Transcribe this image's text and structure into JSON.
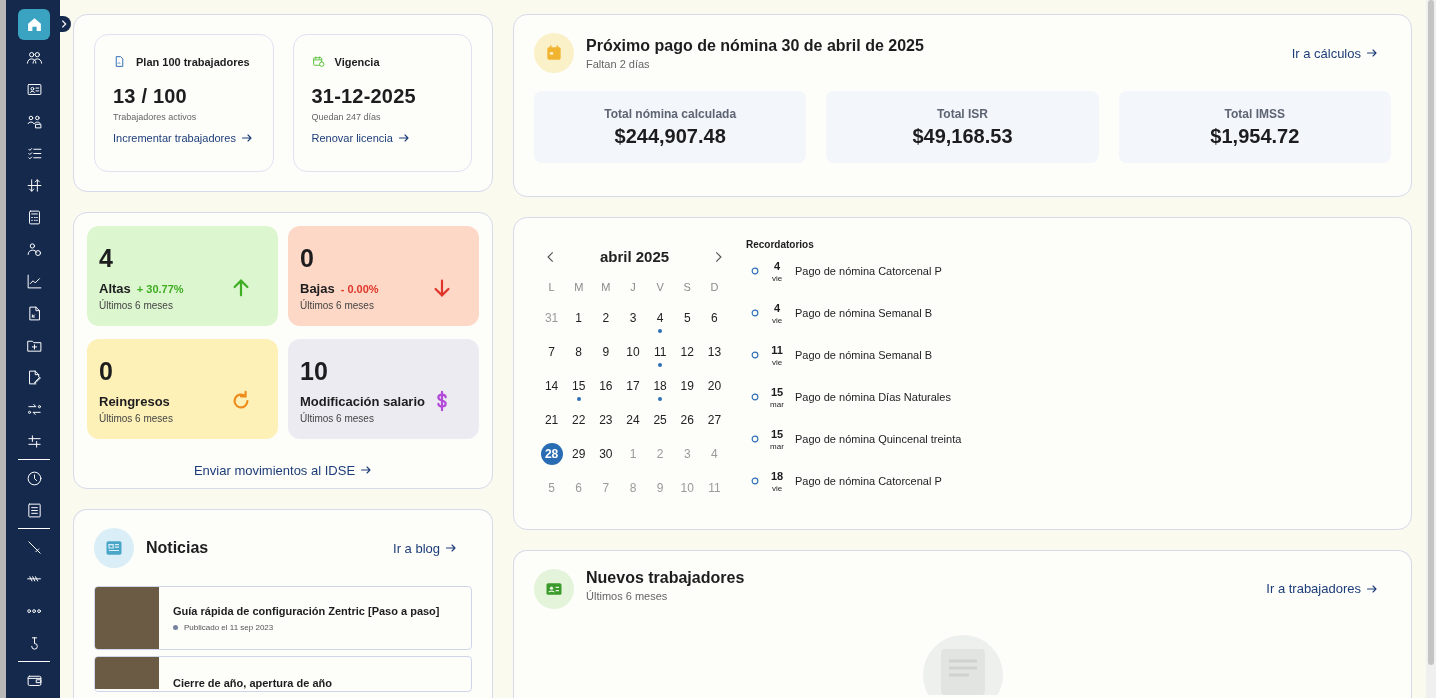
{
  "sidebar": {
    "groups": [
      {
        "items": [
          {
            "kind": "home",
            "selected": true
          },
          {
            "kind": "users",
            "selected": false
          },
          {
            "kind": "id-card",
            "selected": false
          },
          {
            "kind": "people",
            "selected": false
          },
          {
            "kind": "checklist",
            "selected": false
          },
          {
            "kind": "sort",
            "selected": false
          },
          {
            "kind": "calculator",
            "selected": false
          },
          {
            "kind": "user-coins",
            "selected": false
          },
          {
            "kind": "chart",
            "selected": false
          },
          {
            "kind": "file",
            "selected": false
          },
          {
            "kind": "folder-plus",
            "selected": false
          },
          {
            "kind": "file-pen",
            "selected": false
          },
          {
            "kind": "transfer",
            "selected": false
          },
          {
            "kind": "sliders",
            "selected": false
          }
        ]
      },
      {
        "items": [
          {
            "kind": "clock",
            "selected": false
          },
          {
            "kind": "list",
            "selected": false
          }
        ]
      },
      {
        "items": [
          {
            "kind": "tool",
            "selected": false
          },
          {
            "kind": "chain",
            "selected": false
          },
          {
            "kind": "dots",
            "selected": false
          },
          {
            "kind": "hook",
            "selected": false
          }
        ]
      },
      {
        "items": [
          {
            "kind": "wallet",
            "selected": false
          }
        ]
      }
    ]
  },
  "plan": [
    {
      "kind": "plan",
      "title": "Plan 100 trabajadores",
      "value": "13 / 100",
      "caption": "Trabajadores activos",
      "link": "Incrementar trabajadores"
    },
    {
      "kind": "validity",
      "title": "Vigencia",
      "value": "31-12-2025",
      "caption": "Quedan 247 días",
      "link": "Renovar licencia"
    }
  ],
  "payroll": {
    "title": "Próximo pago de nómina 30 de abril de 2025",
    "subtitle": "Faltan 2 días",
    "link": "Ir a cálculos",
    "totals": [
      {
        "label": "Total nómina calculada",
        "value": "$244,907.48"
      },
      {
        "label": "Total ISR",
        "value": "$49,168.53"
      },
      {
        "label": "Total IMSS",
        "value": "$1,954.72"
      }
    ]
  },
  "movements": {
    "tiles": [
      {
        "kind": "up",
        "value": "4",
        "label": "Altas",
        "change": "+ 30.77%",
        "period": "Últimos 6 meses"
      },
      {
        "kind": "down",
        "value": "0",
        "label": "Bajas",
        "change": "- 0.00%",
        "period": "Últimos 6 meses"
      },
      {
        "kind": "rehire",
        "value": "0",
        "label": "Reingresos",
        "period": "Últimos 6 meses"
      },
      {
        "kind": "salary",
        "value": "10",
        "label": "Modificación salario",
        "period": "Últimos 6 meses"
      }
    ],
    "link": "Enviar movimientos al IDSE"
  },
  "calendar": {
    "month": "abril 2025",
    "weekdays": [
      "L",
      "M",
      "M",
      "J",
      "V",
      "S",
      "D"
    ],
    "days": [
      {
        "day": "31",
        "muted": true,
        "event": false,
        "selected": false
      },
      {
        "day": "1",
        "muted": false,
        "event": false,
        "selected": false
      },
      {
        "day": "2",
        "muted": false,
        "event": false,
        "selected": false
      },
      {
        "day": "3",
        "muted": false,
        "event": false,
        "selected": false
      },
      {
        "day": "4",
        "muted": false,
        "event": true,
        "selected": false
      },
      {
        "day": "5",
        "muted": false,
        "event": false,
        "selected": false
      },
      {
        "day": "6",
        "muted": false,
        "event": false,
        "selected": false
      },
      {
        "day": "7",
        "muted": false,
        "event": false,
        "selected": false
      },
      {
        "day": "8",
        "muted": false,
        "event": false,
        "selected": false
      },
      {
        "day": "9",
        "muted": false,
        "event": false,
        "selected": false
      },
      {
        "day": "10",
        "muted": false,
        "event": false,
        "selected": false
      },
      {
        "day": "11",
        "muted": false,
        "event": true,
        "selected": false
      },
      {
        "day": "12",
        "muted": false,
        "event": false,
        "selected": false
      },
      {
        "day": "13",
        "muted": false,
        "event": false,
        "selected": false
      },
      {
        "day": "14",
        "muted": false,
        "event": false,
        "selected": false
      },
      {
        "day": "15",
        "muted": false,
        "event": true,
        "selected": false
      },
      {
        "day": "16",
        "muted": false,
        "event": false,
        "selected": false
      },
      {
        "day": "17",
        "muted": false,
        "event": false,
        "selected": false
      },
      {
        "day": "18",
        "muted": false,
        "event": true,
        "selected": false
      },
      {
        "day": "19",
        "muted": false,
        "event": false,
        "selected": false
      },
      {
        "day": "20",
        "muted": false,
        "event": false,
        "selected": false
      },
      {
        "day": "21",
        "muted": false,
        "event": false,
        "selected": false
      },
      {
        "day": "22",
        "muted": false,
        "event": false,
        "selected": false
      },
      {
        "day": "23",
        "muted": false,
        "event": false,
        "selected": false
      },
      {
        "day": "24",
        "muted": false,
        "event": false,
        "selected": false
      },
      {
        "day": "25",
        "muted": false,
        "event": false,
        "selected": false
      },
      {
        "day": "26",
        "muted": false,
        "event": false,
        "selected": false
      },
      {
        "day": "27",
        "muted": false,
        "event": false,
        "selected": false
      },
      {
        "day": "28",
        "muted": false,
        "event": false,
        "selected": true
      },
      {
        "day": "29",
        "muted": false,
        "event": false,
        "selected": false
      },
      {
        "day": "30",
        "muted": false,
        "event": false,
        "selected": false
      },
      {
        "day": "1",
        "muted": true,
        "event": false,
        "selected": false
      },
      {
        "day": "2",
        "muted": true,
        "event": false,
        "selected": false
      },
      {
        "day": "3",
        "muted": true,
        "event": false,
        "selected": false
      },
      {
        "day": "4",
        "muted": true,
        "event": false,
        "selected": false
      },
      {
        "day": "5",
        "muted": true,
        "event": false,
        "selected": false
      },
      {
        "day": "6",
        "muted": true,
        "event": false,
        "selected": false
      },
      {
        "day": "7",
        "muted": true,
        "event": false,
        "selected": false
      },
      {
        "day": "8",
        "muted": true,
        "event": false,
        "selected": false
      },
      {
        "day": "9",
        "muted": true,
        "event": false,
        "selected": false
      },
      {
        "day": "10",
        "muted": true,
        "event": false,
        "selected": false
      },
      {
        "day": "11",
        "muted": true,
        "event": false,
        "selected": false
      }
    ]
  },
  "reminders": {
    "title": "Recordatorios",
    "items": [
      {
        "day": "4",
        "weekday": "vie",
        "text": "Pago de nómina Catorcenal P"
      },
      {
        "day": "4",
        "weekday": "vie",
        "text": "Pago de nómina Semanal B"
      },
      {
        "day": "11",
        "weekday": "vie",
        "text": "Pago de nómina Semanal B"
      },
      {
        "day": "15",
        "weekday": "mar",
        "text": "Pago de nómina Días Naturales"
      },
      {
        "day": "15",
        "weekday": "mar",
        "text": "Pago de nómina Quincenal treinta"
      },
      {
        "day": "18",
        "weekday": "vie",
        "text": "Pago de nómina Catorcenal P"
      }
    ]
  },
  "news": {
    "title": "Noticias",
    "link": "Ir a blog",
    "items": [
      {
        "title": "Guía rápida de configuración Zentric [Paso a paso]",
        "date": "Publicado el 11 sep 2023"
      },
      {
        "title": "Cierre de año, apertura de año"
      }
    ]
  },
  "new_workers": {
    "title": "Nuevos trabajadores",
    "subtitle": "Últimos 6 meses",
    "link": "Ir a trabajadores"
  }
}
